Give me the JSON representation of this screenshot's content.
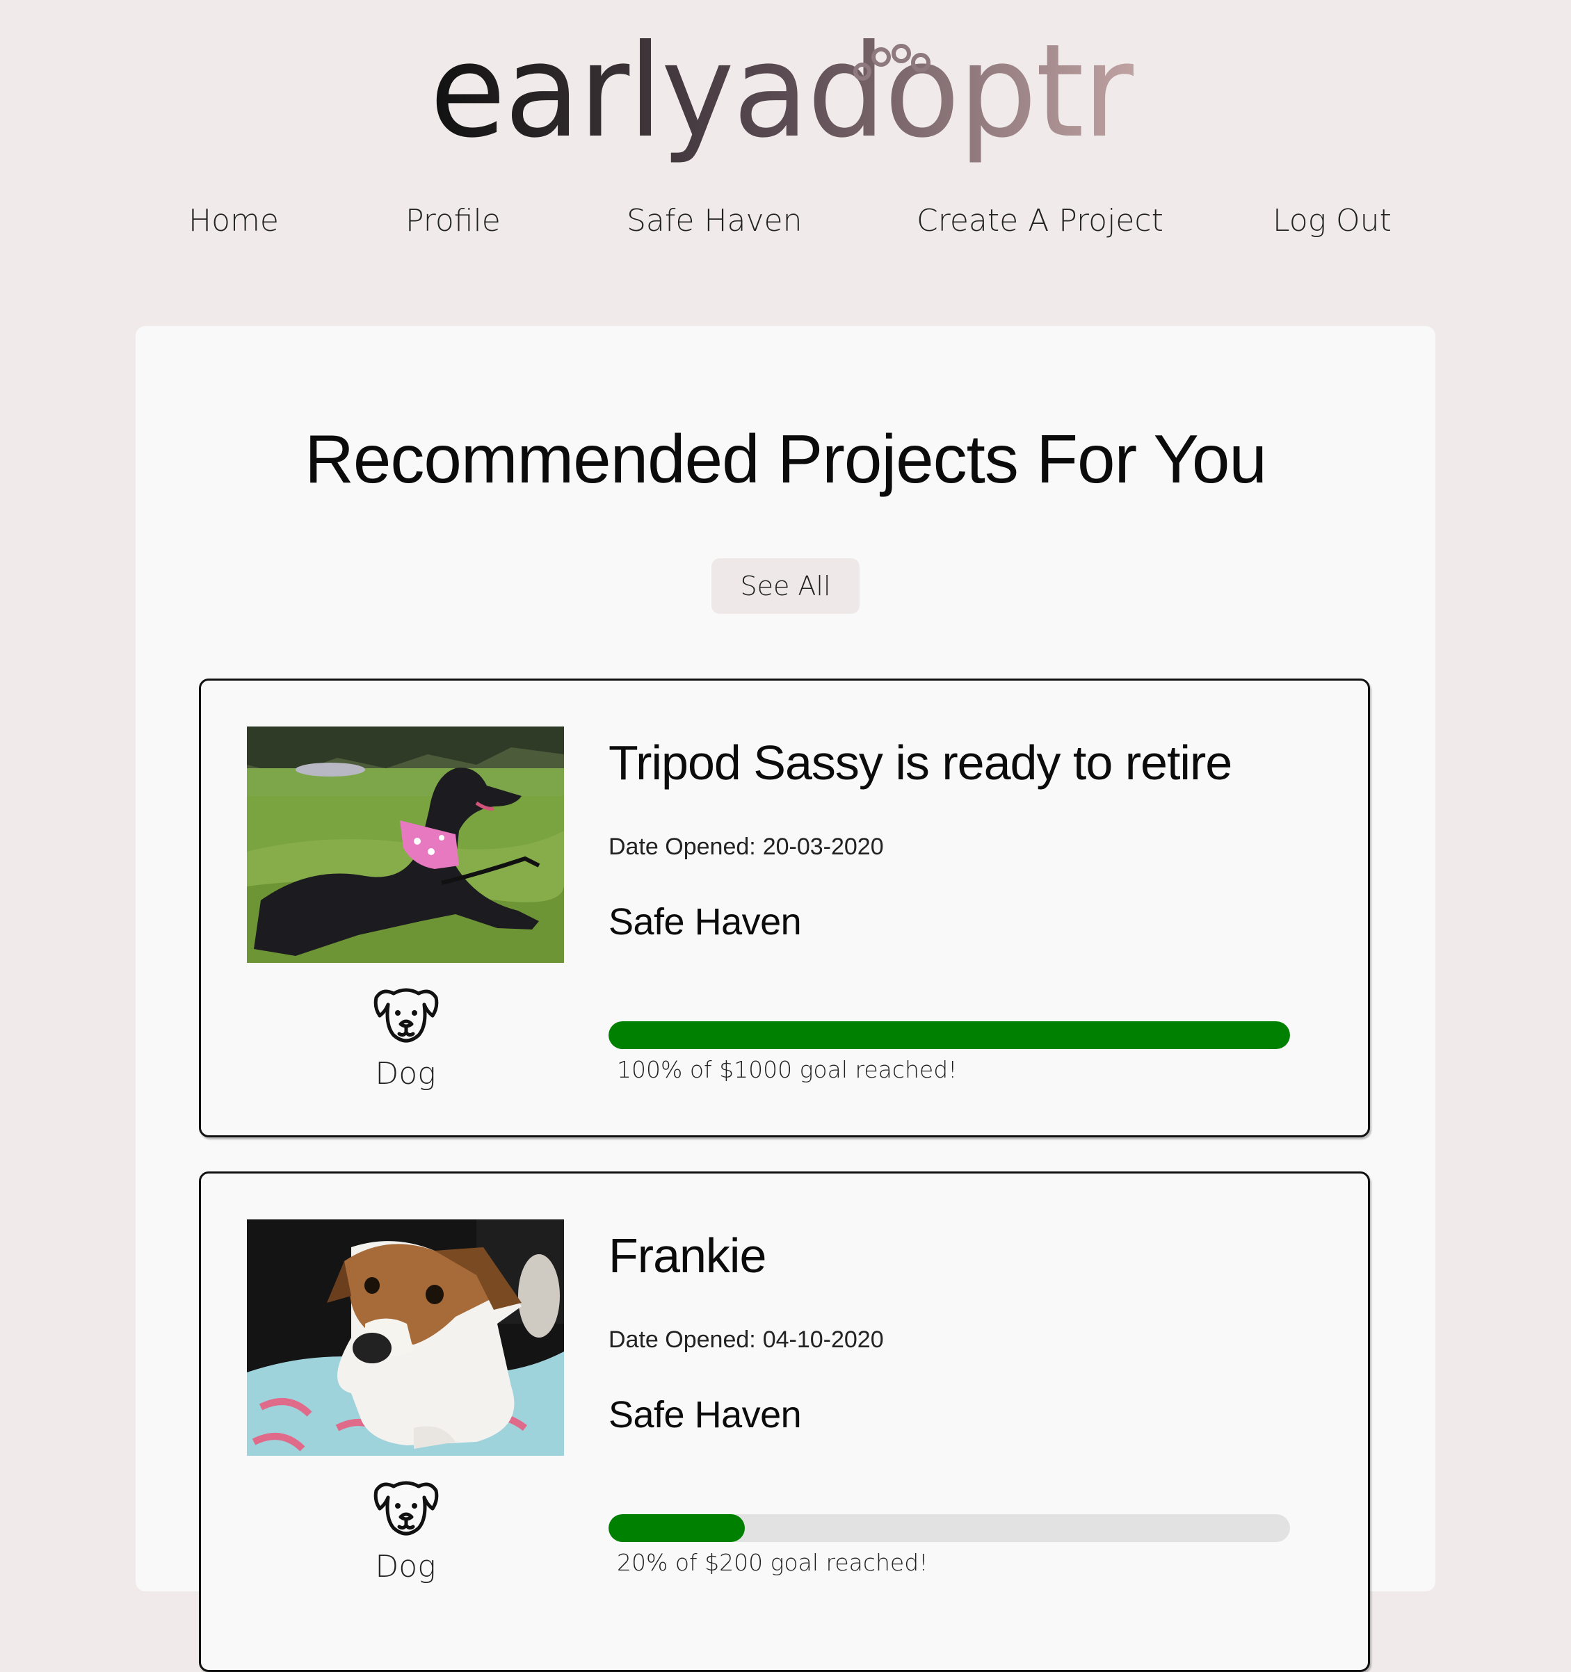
{
  "brand": {
    "logo_text": "earlyadoptr",
    "colors": {
      "gradient_start": "#111111",
      "gradient_mid": "#5a4b52",
      "gradient_end": "#bfa2a2"
    }
  },
  "nav": {
    "items": [
      {
        "label": "Home"
      },
      {
        "label": "Profile"
      },
      {
        "label": "Safe Haven"
      },
      {
        "label": "Create A Project"
      },
      {
        "label": "Log Out"
      }
    ]
  },
  "main": {
    "title": "Recommended Projects For You",
    "see_all_label": "See All"
  },
  "projects": [
    {
      "title": "Tripod Sassy is ready to retire",
      "date_label": "Date Opened:",
      "date": "20-03-2020",
      "organisation": "Safe Haven",
      "species": "Dog",
      "species_icon": "dog-icon",
      "progress_fraction": 1.0,
      "progress_text": "100% of $1000 goal reached!"
    },
    {
      "title": "Frankie",
      "date_label": "Date Opened:",
      "date": "04-10-2020",
      "organisation": "Safe Haven",
      "species": "Dog",
      "species_icon": "dog-icon",
      "progress_fraction": 0.2,
      "progress_text": "20% of $200 goal reached!"
    }
  ],
  "colors": {
    "page_bg": "#f0eaea",
    "panel_bg": "#f9f9f9",
    "progress_fill": "#008000",
    "progress_track": "#e2e2e2"
  }
}
